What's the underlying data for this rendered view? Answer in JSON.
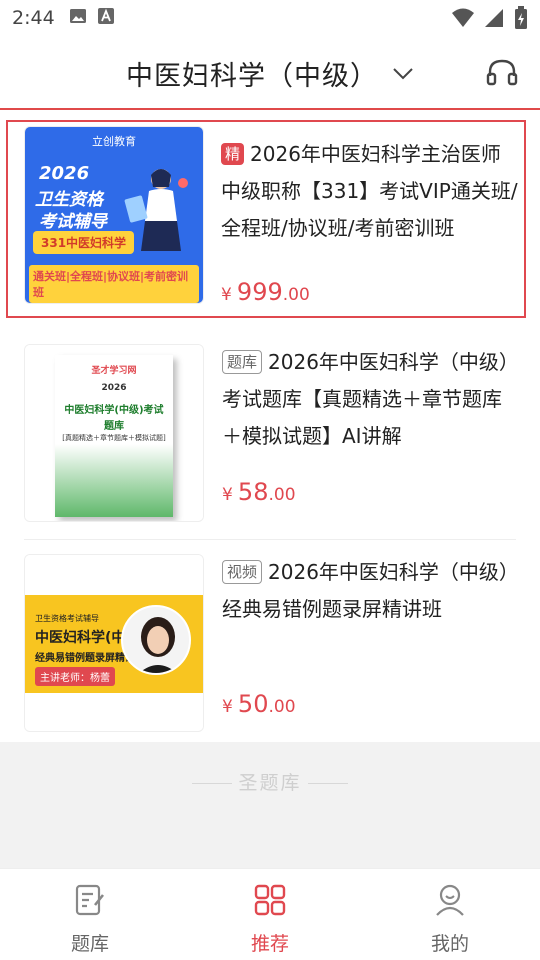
{
  "status_bar": {
    "time": "2:44"
  },
  "header": {
    "title": "中医妇科学（中级）"
  },
  "products": [
    {
      "tag": "精",
      "title": "2026年中医妇科学主治医师中级职称【331】考试VIP通关班/全程班/协议班/考前密训班",
      "price_symbol": "¥",
      "price_int": "999",
      "price_dec": ".00",
      "thumb": {
        "logo": "立创教育",
        "year": "2026",
        "line1": "卫生资格",
        "line2": "考试辅导",
        "badge": "331中医妇科学",
        "strip": "通关班|全程班|协议班|考前密训班"
      }
    },
    {
      "tag": "题库",
      "title": "2026年中医妇科学（中级）考试题库【真题精选＋章节题库＋模拟试题】AI讲解",
      "price_symbol": "¥",
      "price_int": "58",
      "price_dec": ".00",
      "thumb": {
        "brand": "圣才学习网",
        "year": "2026",
        "name": "中医妇科学(中级)考试",
        "sub": "题库",
        "desc": "[真题精选＋章节题库＋模拟试题]"
      }
    },
    {
      "tag": "视频",
      "title": "2026年中医妇科学（中级）经典易错例题录屏精讲班",
      "price_symbol": "¥",
      "price_int": "50",
      "price_dec": ".00",
      "thumb": {
        "top": "卫生资格考试辅导",
        "name": "中医妇科学(中级)",
        "sub": "经典易错例题录屏精讲班",
        "teacher": "主讲老师：杨蕾"
      }
    }
  ],
  "brand_footer": "圣题库",
  "bottom_nav": [
    {
      "label": "题库",
      "icon": "question-bank-icon",
      "active": false
    },
    {
      "label": "推荐",
      "icon": "grid-icon",
      "active": true
    },
    {
      "label": "我的",
      "icon": "user-icon",
      "active": false
    }
  ],
  "colors": {
    "accent": "#e0484f",
    "blue_cover": "#2f6be8",
    "yellow_cover": "#f8c520"
  }
}
